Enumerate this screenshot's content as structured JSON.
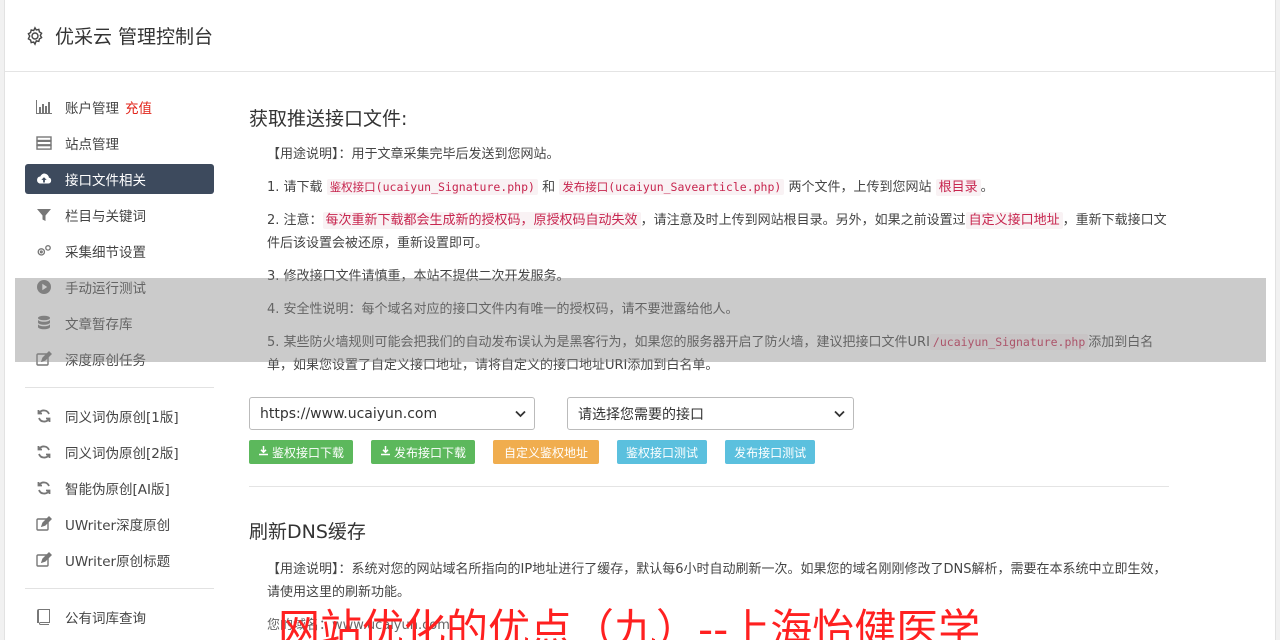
{
  "header": {
    "title": "优采云 管理控制台"
  },
  "sidebar": {
    "items": [
      {
        "label": "账户管理",
        "badge": "充值",
        "icon": "bar-chart-icon"
      },
      {
        "label": "站点管理",
        "icon": "server-icon"
      },
      {
        "label": "接口文件相关",
        "icon": "cloud-upload-icon",
        "active": true
      },
      {
        "label": "栏目与关键词",
        "icon": "filter-icon"
      },
      {
        "label": "采集细节设置",
        "icon": "gears-icon"
      },
      {
        "label": "手动运行测试",
        "icon": "play-circle-icon"
      },
      {
        "label": "文章暂存库",
        "icon": "database-icon"
      },
      {
        "label": "深度原创任务",
        "icon": "edit-icon"
      }
    ],
    "items2": [
      {
        "label": "同义词伪原创[1版]",
        "icon": "refresh-icon"
      },
      {
        "label": "同义词伪原创[2版]",
        "icon": "refresh-icon"
      },
      {
        "label": "智能伪原创[AI版]",
        "icon": "refresh-icon"
      },
      {
        "label": "UWriter深度原创",
        "icon": "edit-icon"
      },
      {
        "label": "UWriter原创标题",
        "icon": "edit-icon"
      }
    ],
    "items3": [
      {
        "label": "公有词库查询",
        "icon": "book-icon"
      }
    ]
  },
  "section1": {
    "title": "获取推送接口文件:",
    "usage_prefix": "【用途说明】：",
    "usage_text": "用于文章采集完毕后发送到您网站。",
    "p1": {
      "a": "1. 请下载",
      "code1": "鉴权接口(ucaiyun_Signature.php)",
      "b": "和",
      "code2": "发布接口(ucaiyun_Savearticle.php)",
      "c": "两个文件，上传到您网站",
      "mark": "根目录",
      "d": "。"
    },
    "p2": {
      "a": "2. 注意：",
      "mark1": "每次重新下载都会生成新的授权码，原授权码自动失效",
      "b": "，请注意及时上传到网站根目录。另外，如果之前设置过",
      "mark2": "自定义接口地址",
      "c": "，重新下载接口文件后该设置会被还原，重新设置即可。"
    },
    "p3": "3. 修改接口文件请慎重，本站不提供二次开发服务。",
    "p4": "4. 安全性说明：每个域名对应的接口文件内有唯一的授权码，请不要泄露给他人。",
    "p5": {
      "a": "5. 某些防火墙规则可能会把我们的自动发布误认为是黑客行为，如果您的服务器开启了防火墙，建议把接口文件URI",
      "code": "/ucaiyun_Signature.php",
      "b": "添加到白名单，如果您设置了自定义接口地址，请将自定义的接口地址URI添加到白名单。"
    },
    "site_select": "https://www.ucaiyun.com",
    "api_select": "请选择您需要的接口",
    "buttons": {
      "b1": "鉴权接口下载",
      "b2": "发布接口下载",
      "b3": "自定义鉴权地址",
      "b4": "鉴权接口测试",
      "b5": "发布接口测试"
    }
  },
  "section2": {
    "title": "刷新DNS缓存",
    "usage_prefix": "【用途说明】：",
    "usage_text": "系统对您的网站域名所指向的IP地址进行了缓存，默认每6小时自动刷新一次。如果您的域名刚刚修改了DNS解析，需要在本系统中立即生效，请使用这里的刷新功能。",
    "partial": "您的域名：www.ucaiyun.com"
  },
  "watermark": "网站优化的优点（九）--上海怡健医学",
  "colors": {
    "active_nav": "#3d4a5d",
    "green": "#5cb85c",
    "orange": "#f0ad4e",
    "blue": "#5bc0de",
    "code": "#c7254e",
    "watermark": "#ff2020"
  }
}
